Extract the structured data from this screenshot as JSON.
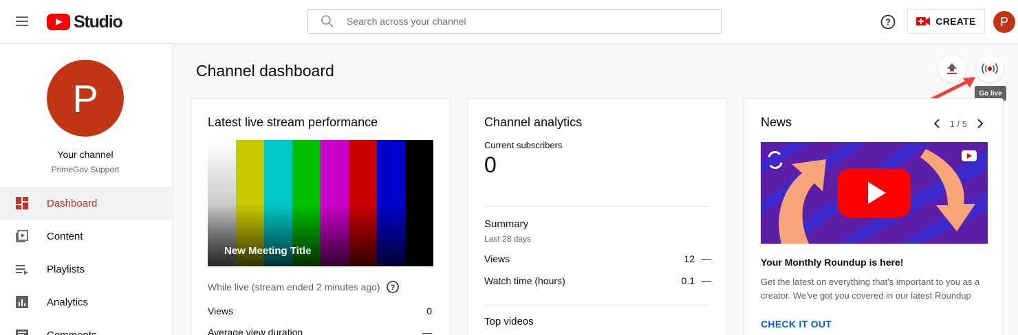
{
  "header": {
    "logo_text": "Studio",
    "search_placeholder": "Search across your channel",
    "create_label": "CREATE",
    "avatar_letter": "P"
  },
  "sidebar": {
    "avatar_letter": "P",
    "channel_label": "Your channel",
    "channel_name": "PrimeGov Support",
    "items": [
      {
        "label": "Dashboard",
        "icon": "dashboard-icon",
        "active": true
      },
      {
        "label": "Content",
        "icon": "content-icon"
      },
      {
        "label": "Playlists",
        "icon": "playlists-icon"
      },
      {
        "label": "Analytics",
        "icon": "analytics-icon"
      },
      {
        "label": "Comments",
        "icon": "comments-icon"
      }
    ]
  },
  "main": {
    "title": "Channel dashboard",
    "golive_tooltip": "Go live"
  },
  "live_card": {
    "title": "Latest live stream performance",
    "video_title": "New Meeting Title",
    "while_live": "While live (stream ended 2 minutes ago)",
    "stats": [
      {
        "label": "Views",
        "value": "0"
      },
      {
        "label": "Average view duration",
        "value": "—"
      }
    ],
    "bar_colors": [
      "#c0c0c0",
      "#c0c000",
      "#00c0c0",
      "#00c000",
      "#c000c0",
      "#c00000",
      "#0000c0",
      "#000000"
    ]
  },
  "analytics_card": {
    "title": "Channel analytics",
    "subs_label": "Current subscribers",
    "subs_value": "0",
    "summary_title": "Summary",
    "summary_sub": "Last 28 days",
    "rows": [
      {
        "label": "Views",
        "value": "12",
        "trend": "—"
      },
      {
        "label": "Watch time (hours)",
        "value": "0.1",
        "trend": "—"
      }
    ],
    "top_videos": "Top videos"
  },
  "news_card": {
    "title": "News",
    "pager": "1 / 5",
    "headline": "Your Monthly Roundup is here!",
    "body": "Get the latest on everything that's important to you as a creator. We've got you covered in our latest Roundup",
    "link": "CHECK IT OUT"
  },
  "colors": {
    "accent_red": "#c4302b",
    "avatar": "#c13515",
    "link_blue": "#065fd4"
  }
}
